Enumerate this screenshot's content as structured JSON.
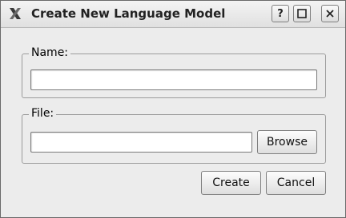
{
  "window": {
    "title": "Create New Language Model",
    "help_button": "?",
    "maximize_glyph": "□",
    "close_glyph": "✕"
  },
  "name_group": {
    "label": "Name:",
    "value": ""
  },
  "file_group": {
    "label": "File:",
    "value": "",
    "browse_label": "Browse"
  },
  "actions": {
    "create_label": "Create",
    "cancel_label": "Cancel"
  },
  "icons": {
    "app": "x-logo-icon",
    "help": "help-icon",
    "maximize": "maximize-icon",
    "close": "close-icon"
  }
}
